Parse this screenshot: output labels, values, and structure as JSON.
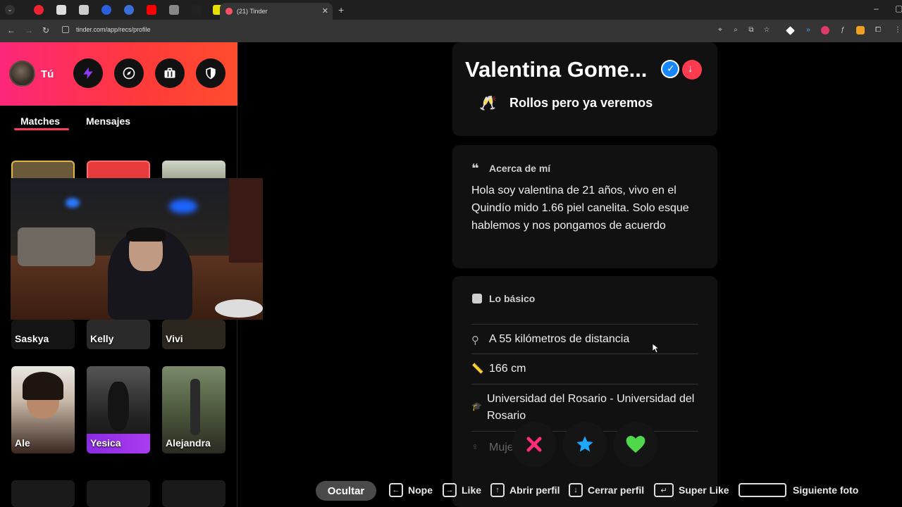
{
  "browser": {
    "tab_title": "(21) Tinder",
    "url": "tinder.com/app/recs/profile"
  },
  "sidebar": {
    "user_label": "Tú",
    "tabs": [
      "Matches",
      "Mensajes"
    ],
    "matches": [
      "Saskya",
      "Kelly",
      "Vivi",
      "Ale",
      "Yesica",
      "Alejandra"
    ]
  },
  "profile": {
    "name": "Valentina Gome...",
    "looking_for": "Rollos pero ya veremos",
    "about_title": "Acerca de mí",
    "about_text": "Hola soy valentina de 21 años, vivo en el Quindío mido 1.66 piel canelita. Solo esque hablemos y nos pongamos de acuerdo",
    "basics_title": "Lo básico",
    "distance": "A 55 kilómetros de distancia",
    "height": "166 cm",
    "school": "Universidad del Rosario - Universidad del Rosario",
    "gender": "Muje"
  },
  "shortcuts": {
    "hide": "Ocultar",
    "nope": "Nope",
    "like": "Like",
    "open_profile": "Abrir perfil",
    "close_profile": "Cerrar perfil",
    "super_like": "Super Like",
    "next_photo": "Siguiente foto"
  },
  "colors": {
    "brand_gradient_start": "#fd267a",
    "brand_gradient_end": "#ff4d2e",
    "nope": "#ff4458",
    "super_like": "#1786ff",
    "like": "#3ad16a"
  }
}
